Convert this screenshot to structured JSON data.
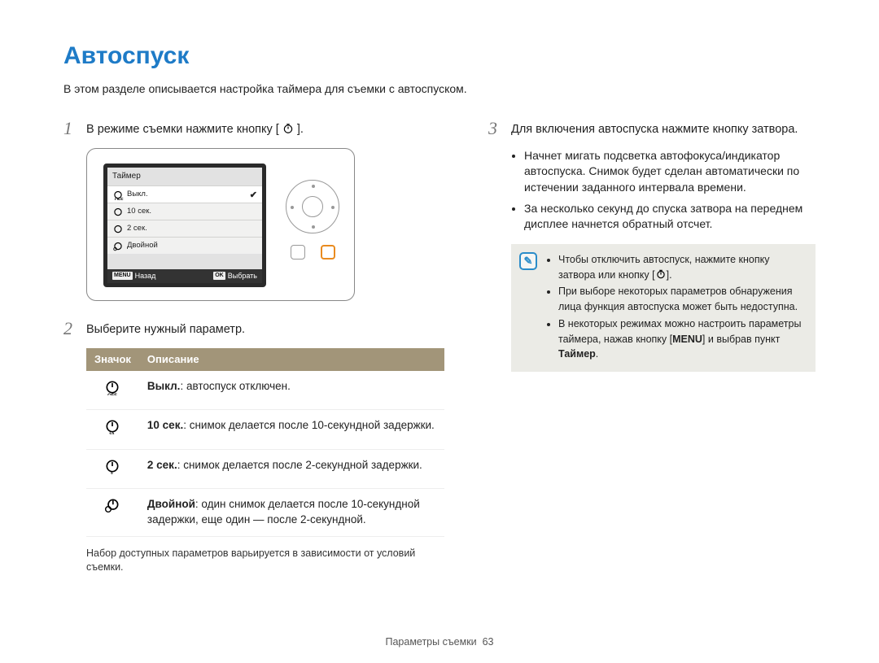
{
  "title": "Автоспуск",
  "intro": "В этом разделе описывается настройка таймера для съемки с автоспуском.",
  "left": {
    "step1": {
      "num": "1",
      "text_a": "В режиме съемки нажмите кнопку [",
      "text_b": "]."
    },
    "screen": {
      "title": "Таймер",
      "items": [
        {
          "label": "Выкл.",
          "selected": true
        },
        {
          "label": "10 сек."
        },
        {
          "label": "2 сек."
        },
        {
          "label": "Двойной"
        }
      ],
      "back_key": "MENU",
      "back_label": "Назад",
      "ok_key": "OK",
      "ok_label": "Выбрать"
    },
    "step2": {
      "num": "2",
      "text": "Выберите нужный параметр."
    },
    "table": {
      "h_icon": "Значок",
      "h_desc": "Описание",
      "rows": [
        {
          "b": "Выкл.",
          "t": ": автоспуск отключен."
        },
        {
          "b": "10 сек.",
          "t": ": снимок делается после 10-секундной задержки."
        },
        {
          "b": "2 сек.",
          "t": ": снимок делается после 2-секундной задержки."
        },
        {
          "b": "Двойной",
          "t": ": один снимок делается после 10-секундной задержки, еще один — после 2-секундной."
        }
      ]
    },
    "under_note": "Набор доступных параметров варьируется в зависимости от условий съемки."
  },
  "right": {
    "step3": {
      "num": "3",
      "text": "Для включения автоспуска нажмите кнопку затвора."
    },
    "bullets": [
      "Начнет мигать подсветка автофокуса/индикатор автоспуска. Снимок будет сделан автоматически по истечении заданного интервала времени.",
      "За несколько секунд до спуска затвора на переднем дисплее начнется обратный отсчет."
    ],
    "info": {
      "l1a": "Чтобы отключить автоспуск, нажмите кнопку затвора или кнопку [",
      "l1b": "].",
      "l2": "При выборе некоторых параметров обнаружения лица функция автоспуска может быть недоступна.",
      "l3a": "В некоторых режимах можно настроить параметры таймера, нажав кнопку [",
      "l3_menu": "MENU",
      "l3b": "] и выбрав пункт ",
      "l3_bold": "Таймер",
      "l3c": "."
    }
  },
  "footer": {
    "section": "Параметры съемки",
    "page": "63"
  }
}
